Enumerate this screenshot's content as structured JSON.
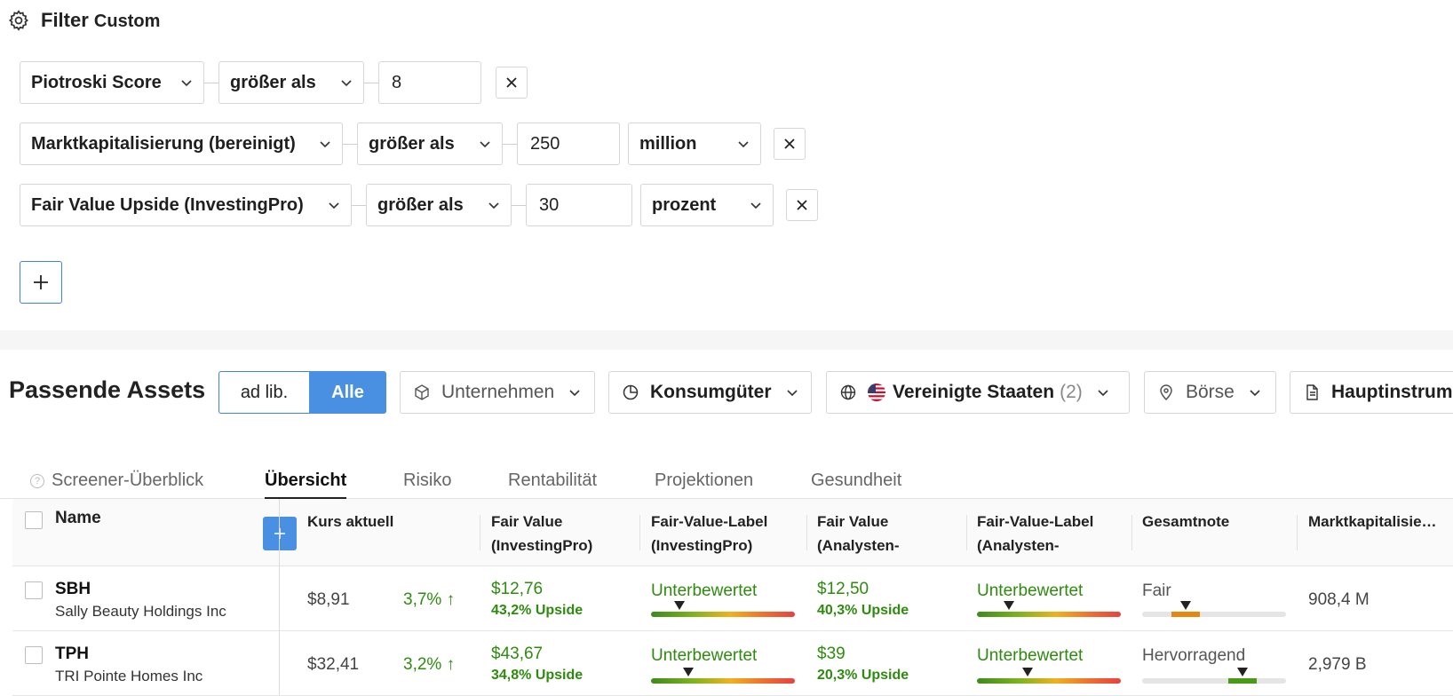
{
  "filter": {
    "title": "Filter",
    "subtitle": "Custom",
    "rows": [
      {
        "field": "Piotroski Score",
        "op": "größer als",
        "value": "8",
        "unit": ""
      },
      {
        "field": "Marktkapitalisierung (bereinigt)",
        "op": "größer als",
        "value": "250",
        "unit": "million"
      },
      {
        "field": "Fair Value Upside (InvestingPro)",
        "op": "größer als",
        "value": "30",
        "unit": "prozent"
      }
    ]
  },
  "assets": {
    "title": "Passende Assets",
    "toggle_left": "ad lib.",
    "toggle_right": "Alle",
    "filters": {
      "sector": "Unternehmen",
      "industry": "Konsumgüter",
      "country": "Vereinigte Staaten",
      "country_count": "(2)",
      "exchange": "Börse",
      "instrument": "Hauptinstrum"
    }
  },
  "tabs": [
    "Screener-Überblick",
    "Übersicht",
    "Risiko",
    "Rentabilität",
    "Projektionen",
    "Gesundheit"
  ],
  "active_tab": "Übersicht",
  "table": {
    "headers": {
      "name": "Name",
      "price": "Kurs aktuell",
      "fv_pro_1": "Fair Value",
      "fv_pro_2": "(InvestingPro)",
      "fvl_pro_1": "Fair-Value-Label",
      "fvl_pro_2": "(InvestingPro)",
      "fv_an_1": "Fair Value",
      "fv_an_2": "(Analysten-",
      "fvl_an_1": "Fair-Value-Label",
      "fvl_an_2": "(Analysten-",
      "grade": "Gesamtnote",
      "mcap": "Marktkapitalisie…"
    },
    "rows": [
      {
        "ticker": "SBH",
        "company": "Sally Beauty Holdings Inc",
        "price": "$8,91",
        "change": "3,7%",
        "fv_pro": "$12,76",
        "fv_pro_upside": "43,2% Upside",
        "fvl_pro": "Unterbewertet",
        "fvl_pro_pos": 0.2,
        "fv_an": "$12,50",
        "fv_an_upside": "40,3% Upside",
        "fvl_an": "Unterbewertet",
        "fvl_an_pos": 0.22,
        "grade": "Fair",
        "grade_level": 0.3,
        "grade_color": "#e8870f",
        "mcap": "908,4 M"
      },
      {
        "ticker": "TPH",
        "company": "TRI Pointe Homes Inc",
        "price": "$32,41",
        "change": "3,2%",
        "fv_pro": "$43,67",
        "fv_pro_upside": "34,8% Upside",
        "fvl_pro": "Unterbewertet",
        "fvl_pro_pos": 0.26,
        "fv_an": "$39",
        "fv_an_upside": "20,3% Upside",
        "fvl_an": "Unterbewertet",
        "fvl_an_pos": 0.35,
        "grade": "Hervorragend",
        "grade_level": 0.7,
        "grade_color": "#4a9a1a",
        "mcap": "2,979 B"
      }
    ]
  }
}
